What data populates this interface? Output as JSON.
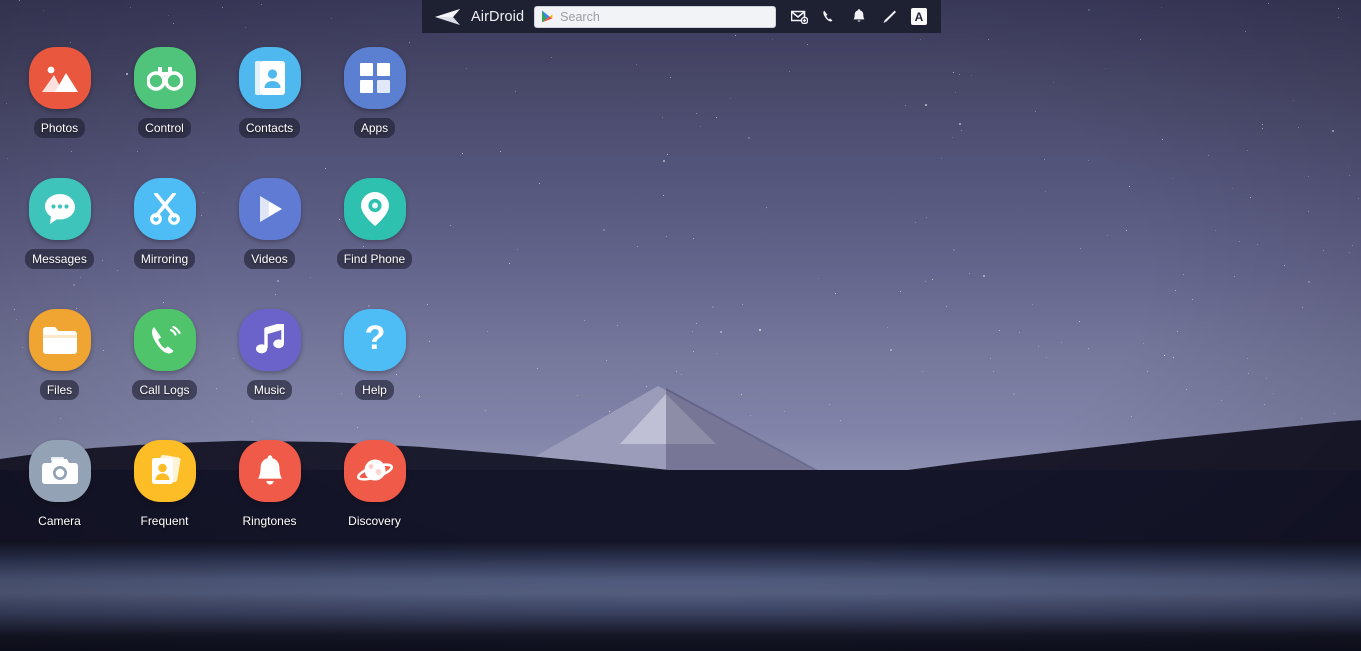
{
  "toolbar": {
    "brand": "AirDroid",
    "logo_icon": "airdroid-paper-plane-logo",
    "search": {
      "placeholder": "Search",
      "value": "",
      "leading_icon": "google-play-icon"
    },
    "actions": [
      {
        "name": "new-message-icon",
        "label": "New Message",
        "icon": "envelope-plus-icon"
      },
      {
        "name": "call-icon",
        "label": "Call",
        "icon": "phone-handset-icon"
      },
      {
        "name": "notifications-icon",
        "label": "Notifications",
        "icon": "bell-icon"
      },
      {
        "name": "compose-icon",
        "label": "Compose",
        "icon": "pencil-icon"
      },
      {
        "name": "text-tool-icon",
        "label": "A",
        "icon": "letter-a-icon"
      }
    ]
  },
  "desktop": {
    "wallpaper_description": "Mount Fuji at dusk under a starry purple sky with dark forest ridge and misty lake",
    "apps": [
      {
        "label": "Photos",
        "icon": "photos-icon",
        "bg": "#e9573f",
        "label_style": "pill"
      },
      {
        "label": "Control",
        "icon": "binoculars-icon",
        "bg": "#4fc47a",
        "label_style": "pill"
      },
      {
        "label": "Contacts",
        "icon": "contacts-icon",
        "bg": "#4fb8ef",
        "label_style": "pill"
      },
      {
        "label": "Apps",
        "icon": "grid-icon",
        "bg": "#5b7fd1",
        "label_style": "pill"
      },
      {
        "label": "Messages",
        "icon": "chat-bubble-icon",
        "bg": "#3fc4bb",
        "label_style": "pill"
      },
      {
        "label": "Mirroring",
        "icon": "scissors-icon",
        "bg": "#4fbdf5",
        "label_style": "pill"
      },
      {
        "label": "Videos",
        "icon": "play-icon",
        "bg": "#5f7bd4",
        "label_style": "pill"
      },
      {
        "label": "Find Phone",
        "icon": "map-pin-icon",
        "bg": "#2ec1b0",
        "label_style": "pill"
      },
      {
        "label": "Files",
        "icon": "folder-icon",
        "bg": "#f0a431",
        "label_style": "pill"
      },
      {
        "label": "Call Logs",
        "icon": "phone-icon",
        "bg": "#4fc46b",
        "label_style": "pill"
      },
      {
        "label": "Music",
        "icon": "music-note-icon",
        "bg": "#6b63c9",
        "label_style": "pill"
      },
      {
        "label": "Help",
        "icon": "question-icon",
        "bg": "#4fbdf5",
        "label_style": "pill"
      },
      {
        "label": "Camera",
        "icon": "camera-icon",
        "bg": "#93a3b5",
        "label_style": "plain"
      },
      {
        "label": "Frequent",
        "icon": "frequent-icon",
        "bg": "#fcbd26",
        "label_style": "plain"
      },
      {
        "label": "Ringtones",
        "icon": "bell-icon",
        "bg": "#ef5b48",
        "label_style": "plain"
      },
      {
        "label": "Discovery",
        "icon": "planet-icon",
        "bg": "#ef5b48",
        "label_style": "plain"
      }
    ]
  },
  "colors": {
    "toolbar_bg": "#1e2132",
    "label_pill_bg": "rgba(30,30,48,0.62)",
    "sky_top": "#3b3a5c",
    "sky_bottom": "#8c8fb0"
  }
}
